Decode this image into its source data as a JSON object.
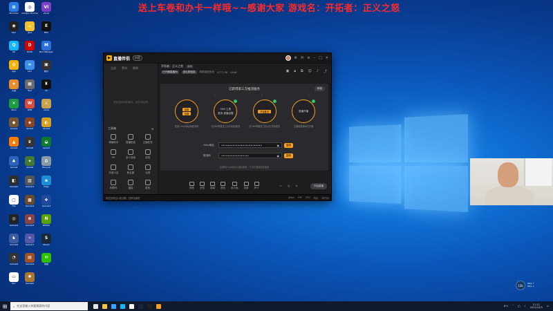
{
  "banner": {
    "text": "送上车卷和办卡一样哦~~感谢大家  游戏名：开拓者：正义之怒"
  },
  "desktop": {
    "icons": [
      {
        "label": "Windows",
        "color": "#2a7be4",
        "glyph": "⊞"
      },
      {
        "label": "Google Chrome",
        "color": "#ffffff",
        "glyph": "◎"
      },
      {
        "label": "Visual",
        "color": "#7b3fc6",
        "glyph": "VI"
      },
      {
        "label": "Epic",
        "color": "#222222",
        "glyph": "◉"
      },
      {
        "label": "Java",
        "color": "#f2c12e",
        "glyph": "☕"
      },
      {
        "label": "EPIC",
        "color": "#111111",
        "glyph": "E"
      },
      {
        "label": "QQ",
        "color": "#12b7f5",
        "glyph": "Q"
      },
      {
        "label": "DOTA",
        "color": "#d40000",
        "glyph": "D"
      },
      {
        "label": "Mod Manager",
        "color": "#2a6fd6",
        "glyph": "M"
      },
      {
        "label": "App",
        "color": "#f5b20b",
        "glyph": "◍"
      },
      {
        "label": "Link",
        "color": "#3e8ee8",
        "glyph": "∞"
      },
      {
        "label": "腾讯",
        "color": "#333",
        "glyph": "▣"
      },
      {
        "label": "小说",
        "color": "#e88b2a",
        "glyph": "★"
      },
      {
        "label": "Tool",
        "color": "#6b6b6b",
        "glyph": "▦"
      },
      {
        "label": "Qt",
        "color": "#111",
        "glyph": "♜"
      },
      {
        "label": "Xbox",
        "color": "#1f9a3f",
        "glyph": "✕"
      },
      {
        "label": "WPS",
        "color": "#d94a3a",
        "glyph": "W"
      },
      {
        "label": "Game",
        "color": "#c9a24b",
        "glyph": "⚔"
      },
      {
        "label": "Game2",
        "color": "#775533",
        "glyph": "◆"
      },
      {
        "label": "Game3",
        "color": "#884422",
        "glyph": "◈"
      },
      {
        "label": "Game4",
        "color": "#d9a020",
        "glyph": "◐"
      },
      {
        "label": "Game5",
        "color": "#ff7b00",
        "glyph": "▲"
      },
      {
        "label": "Game6",
        "color": "#333",
        "glyph": "♛"
      },
      {
        "label": "Game7",
        "color": "#0e7a2e",
        "glyph": "◒"
      },
      {
        "label": "Game8",
        "color": "#2b63b8",
        "glyph": "♣"
      },
      {
        "label": "Game9",
        "color": "#447733",
        "glyph": "✦"
      },
      {
        "label": "Recycle",
        "color": "#8a9aa6",
        "glyph": "♻"
      },
      {
        "label": "Game10",
        "color": "#2d2d2d",
        "glyph": "◧"
      },
      {
        "label": "Game11",
        "color": "#555",
        "glyph": "▧"
      },
      {
        "label": "Edge",
        "color": "#1e8fd6",
        "glyph": "e"
      },
      {
        "label": "File",
        "color": "#ffffff",
        "glyph": "▢"
      },
      {
        "label": "Game12",
        "color": "#6b4b2b",
        "glyph": "▩"
      },
      {
        "label": "Game13",
        "color": "#1f4a9a",
        "glyph": "❖"
      },
      {
        "label": "Game14",
        "color": "#222",
        "glyph": "◎"
      },
      {
        "label": "Game15",
        "color": "#884444",
        "glyph": "⊗"
      },
      {
        "label": "NVIDIA",
        "color": "#5aa300",
        "glyph": "N"
      },
      {
        "label": "Game16",
        "color": "#3a5ba0",
        "glyph": "♞"
      },
      {
        "label": "Game17",
        "color": "#5555aa",
        "glyph": "✧"
      },
      {
        "label": "Steam",
        "color": "#1b2838",
        "glyph": "S"
      },
      {
        "label": "Game18",
        "color": "#333",
        "glyph": "◔"
      },
      {
        "label": "Game19",
        "color": "#a05020",
        "glyph": "▤"
      },
      {
        "label": "微信",
        "color": "#2dc100",
        "glyph": "✉"
      },
      {
        "label": "Doc",
        "color": "#fff",
        "glyph": "▭"
      },
      {
        "label": "Game20",
        "color": "#aa7733",
        "glyph": "✱"
      }
    ]
  },
  "app": {
    "brand": "直播伴侣",
    "version": "抖音",
    "sidebar": {
      "tabs": [
        "全部",
        "素材",
        "摄像"
      ],
      "empty_text": "你还没有添加素材，快去添加吧",
      "tools_label": "工具箱",
      "tools": [
        {
          "label": "弹幕助手"
        },
        {
          "label": "直播贴纸"
        },
        {
          "label": "主播任务"
        },
        {
          "label": "PK"
        },
        {
          "label": "多人连线"
        },
        {
          "label": "连线"
        },
        {
          "label": "抖音小店"
        },
        {
          "label": "粉丝团"
        },
        {
          "label": "礼物"
        },
        {
          "label": "购物车"
        },
        {
          "label": "福袋"
        },
        {
          "label": "更多"
        }
      ]
    },
    "main": {
      "header_label": "开拓者：正义之怒",
      "header_tag": "游戏",
      "sub_tags": [
        "已开通直播间",
        "送礼物信息",
        "网络延迟优化",
        "4777-96",
        "4446"
      ],
      "panel_title": "已获得第三方推流服务",
      "guide_button": "教程",
      "steps": [
        {
          "chip1": "复制",
          "chip2": "复制",
          "text": "",
          "caption": "复制 rtmp地址和推流码"
        },
        {
          "chip1": "",
          "chip2": "",
          "text": "OBS 工具",
          "text2": "推流-直播设置",
          "caption": "在OBS等推流工具中粘贴推流"
        },
        {
          "chip1": "开始推流",
          "chip2": "",
          "text": "",
          "caption": "在OBS等推流工具点击开始推流"
        },
        {
          "chip1": "",
          "chip2": "",
          "text": "直播开播",
          "caption": "主播端直播间已开播"
        }
      ],
      "fields": [
        {
          "label": "rtmp地址",
          "value": "•••••••••••••••••••••••••",
          "button": "复制"
        },
        {
          "label": "推流码",
          "value": "•••••••••••••••••",
          "button": "复制"
        }
      ],
      "hint": "如遇到rtmp地址出错请刷新，下次可直接复制使用",
      "bottom_tools": [
        "美颜",
        "滤镜",
        "绿幕",
        "音效",
        "画中画",
        "场景",
        "声卡"
      ],
      "go_live": "开始直播"
    },
    "statusbar": {
      "left": "你还没有加入粉丝群，快来创建吧",
      "right": [
        "0kb/s",
        "FPS",
        "CPU",
        "内存",
        "3时3分"
      ]
    }
  },
  "taskbar": {
    "search_placeholder": "在这里输入你要搜索的内容",
    "weather": "8°C",
    "clock_time": "11:12",
    "clock_date": "2021/12/3"
  },
  "netwidget": {
    "value": "12k",
    "line1": "0K/s ↑",
    "line2": "0K/s ↓"
  }
}
